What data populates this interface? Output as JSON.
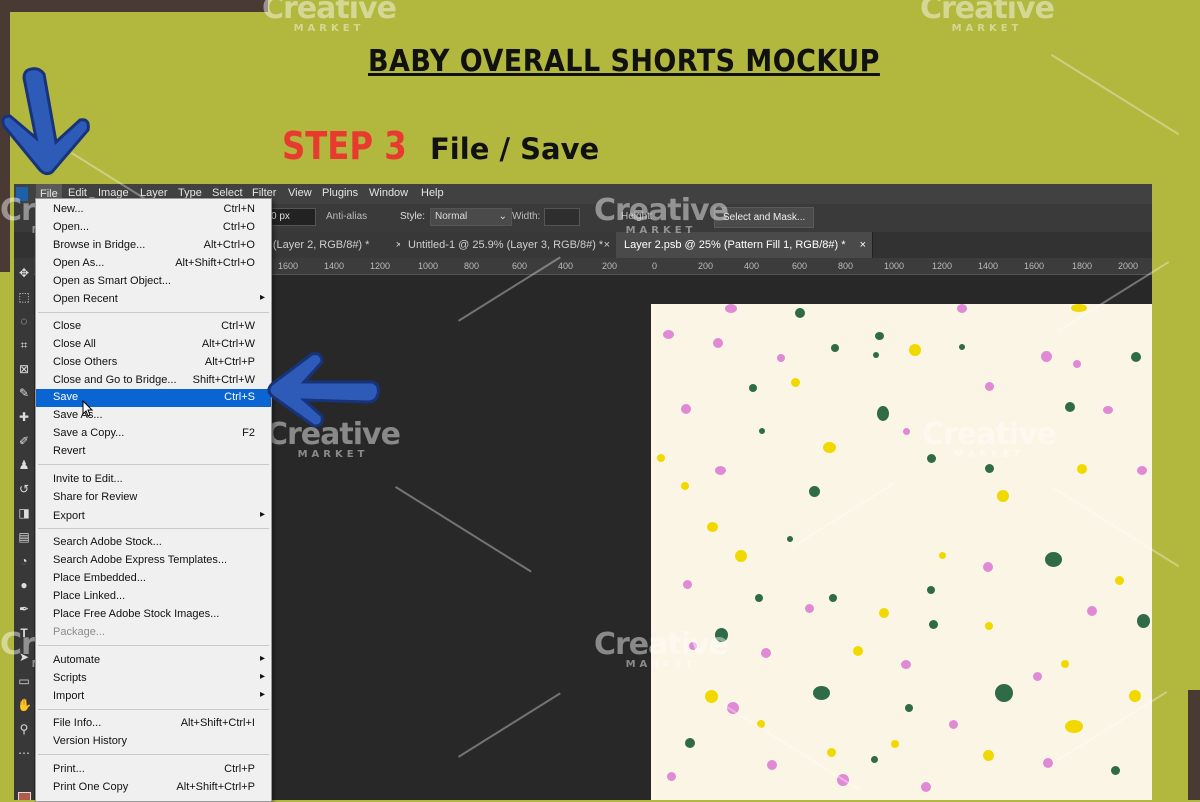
{
  "page": {
    "title": "BABY OVERALL SHORTS MOCKUP",
    "step": "STEP 3",
    "step_action": "File / Save",
    "watermark": {
      "brand": "Creative",
      "sub": "MARKET"
    }
  },
  "app": {
    "menubar": [
      "File",
      "Edit",
      "Image",
      "Layer",
      "Type",
      "Select",
      "Filter",
      "View",
      "Plugins",
      "Window",
      "Help"
    ],
    "options": {
      "size_value": "0 px",
      "anti_alias": "Anti-alias",
      "style_label": "Style:",
      "style_value": "Normal",
      "width_label": "Width:",
      "height_label": "Height:",
      "select_mask": "Select and Mask..."
    },
    "tabs": [
      {
        "label": "% (Layer 2, RGB/8#) *",
        "close": "×"
      },
      {
        "label": "Untitled-1 @ 25.9% (Layer 3, RGB/8#) *",
        "close": "×"
      },
      {
        "label": "Layer 2.psb @ 25% (Pattern Fill 1, RGB/8#) *",
        "close": "×"
      }
    ],
    "ruler": [
      "1600",
      "1400",
      "1200",
      "1000",
      "800",
      "600",
      "400",
      "200",
      "0",
      "200",
      "400",
      "600",
      "800",
      "1000",
      "1200",
      "1400",
      "1600",
      "1800",
      "2000"
    ]
  },
  "file_menu": {
    "items": [
      {
        "label": "New...",
        "shortcut": "Ctrl+N"
      },
      {
        "label": "Open...",
        "shortcut": "Ctrl+O"
      },
      {
        "label": "Browse in Bridge...",
        "shortcut": "Alt+Ctrl+O"
      },
      {
        "label": "Open As...",
        "shortcut": "Alt+Shift+Ctrl+O"
      },
      {
        "label": "Open as Smart Object...",
        "shortcut": ""
      },
      {
        "label": "Open Recent",
        "shortcut": "",
        "submenu": true
      },
      {
        "label": "Close",
        "shortcut": "Ctrl+W"
      },
      {
        "label": "Close All",
        "shortcut": "Alt+Ctrl+W"
      },
      {
        "label": "Close Others",
        "shortcut": "Alt+Ctrl+P"
      },
      {
        "label": "Close and Go to Bridge...",
        "shortcut": "Shift+Ctrl+W"
      },
      {
        "label": "Save",
        "shortcut": "Ctrl+S",
        "selected": true
      },
      {
        "label": "Save As...",
        "shortcut": ""
      },
      {
        "label": "Save a Copy...",
        "shortcut": "F2"
      },
      {
        "label": "Revert",
        "shortcut": ""
      },
      {
        "label": "Invite to Edit...",
        "shortcut": ""
      },
      {
        "label": "Share for Review",
        "shortcut": ""
      },
      {
        "label": "Export",
        "shortcut": "",
        "submenu": true
      },
      {
        "label": "Search Adobe Stock...",
        "shortcut": ""
      },
      {
        "label": "Search Adobe Express Templates...",
        "shortcut": ""
      },
      {
        "label": "Place Embedded...",
        "shortcut": ""
      },
      {
        "label": "Place Linked...",
        "shortcut": ""
      },
      {
        "label": "Place Free Adobe Stock Images...",
        "shortcut": ""
      },
      {
        "label": "Package...",
        "shortcut": "",
        "disabled": true
      },
      {
        "label": "Automate",
        "shortcut": "",
        "submenu": true
      },
      {
        "label": "Scripts",
        "shortcut": "",
        "submenu": true
      },
      {
        "label": "Import",
        "shortcut": "",
        "submenu": true
      },
      {
        "label": "File Info...",
        "shortcut": "Alt+Shift+Ctrl+I"
      },
      {
        "label": "Version History",
        "shortcut": ""
      },
      {
        "label": "Print...",
        "shortcut": "Ctrl+P"
      },
      {
        "label": "Print One Copy",
        "shortcut": "Alt+Shift+Ctrl+P"
      }
    ]
  },
  "colors": {
    "background": "#b2b73e",
    "step_red": "#e83a2f",
    "arrow_blue": "#2f5bb8",
    "canvas": "#fbf5e6",
    "dot_pink": "#e08ad6",
    "dot_green": "#2f6b46",
    "dot_yellow": "#f1d900",
    "menu_selected": "#0a64d2"
  }
}
